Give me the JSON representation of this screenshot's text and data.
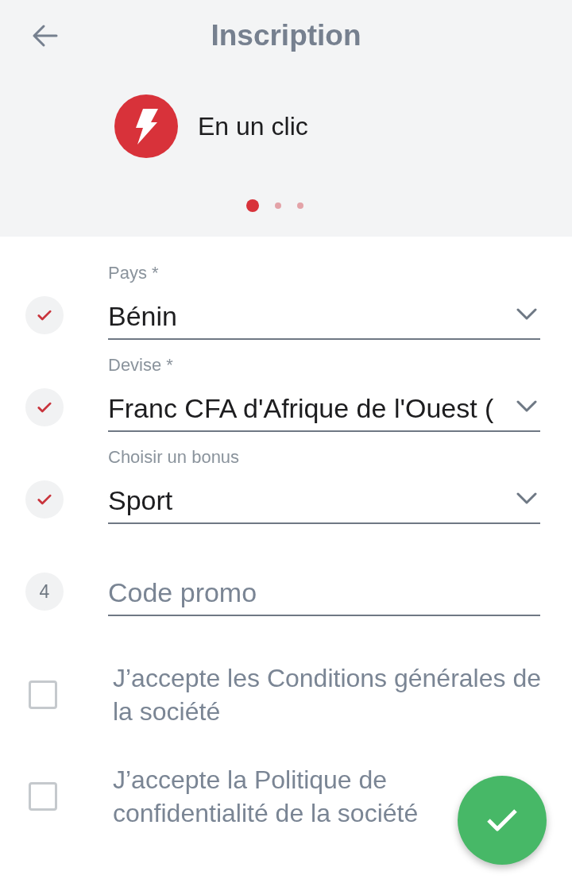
{
  "header": {
    "title": "Inscription"
  },
  "method": {
    "label": "En un clic"
  },
  "pager": [
    {
      "selected": true
    },
    {
      "selected": false
    },
    {
      "selected": false
    }
  ],
  "fields": [
    {
      "kind": "select",
      "done": true,
      "label": "Pays *",
      "value": "Bénin"
    },
    {
      "kind": "select",
      "done": true,
      "label": "Devise *",
      "value": "Franc CFA d'Afrique de l'Ouest ("
    },
    {
      "kind": "select",
      "done": true,
      "label": "Choisir un bonus",
      "value": "Sport"
    },
    {
      "kind": "input",
      "done": false,
      "step": "4",
      "placeholder": "Code promo"
    }
  ],
  "agreements": [
    {
      "text": "J’accepte les Conditions générales de la société",
      "checked": false
    },
    {
      "text": "J’accepte la Politique de confidentialité de la société",
      "checked": false
    }
  ]
}
